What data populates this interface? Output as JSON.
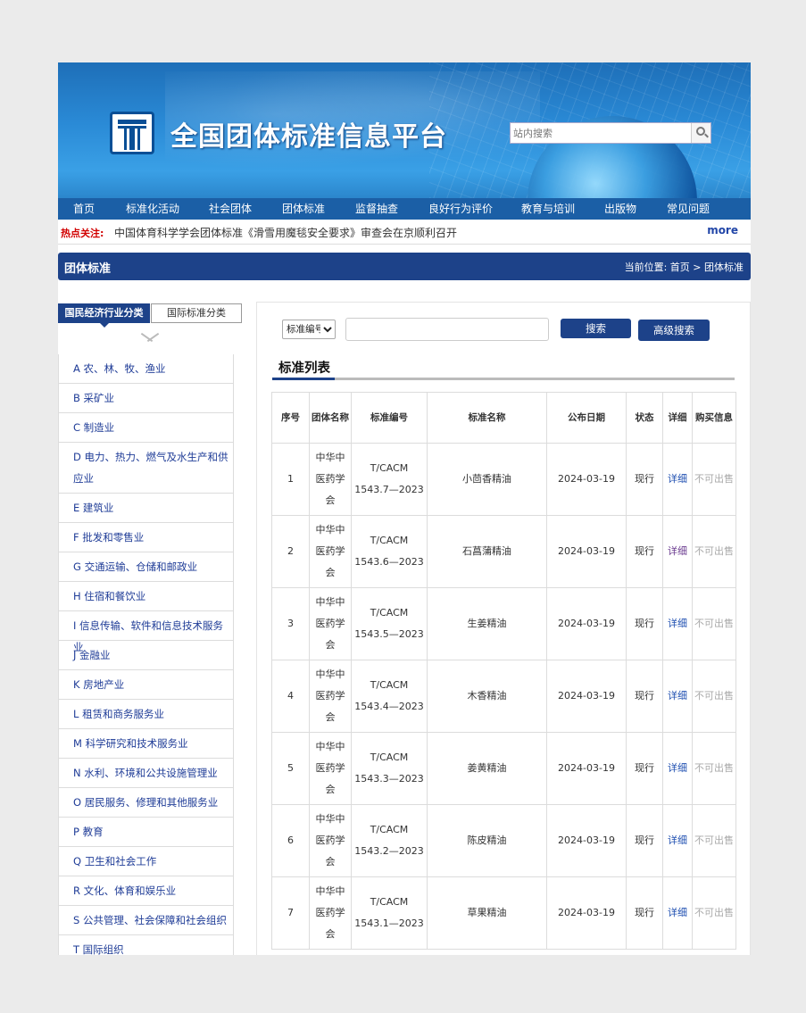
{
  "header": {
    "site_title": "全国团体标准信息平台",
    "search_placeholder": "站内搜索"
  },
  "nav": [
    "首页",
    "标准化活动",
    "社会团体",
    "团体标准",
    "监督抽查",
    "良好行为评价",
    "教育与培训",
    "出版物",
    "常见问题"
  ],
  "hot": {
    "label": "热点关注:",
    "text": "中国体育科学学会团体标准《滑雪用魔毯安全要求》审查会在京顺利召开",
    "more": "more"
  },
  "section": {
    "title": "团体标准",
    "breadcrumb": "当前位置: 首页 > 团体标准"
  },
  "sidebar": {
    "tab_active": "国民经济行业分类",
    "tab_other": "国际标准分类",
    "categories": [
      "A 农、林、牧、渔业",
      "B 采矿业",
      "C 制造业",
      "D 电力、热力、燃气及水生产和供应业",
      "E 建筑业",
      "F 批发和零售业",
      "G 交通运输、仓储和邮政业",
      "H 住宿和餐饮业",
      "I 信息传输、软件和信息技术服务业",
      "J 金融业",
      "K 房地产业",
      "L 租赁和商务服务业",
      "M 科学研究和技术服务业",
      "N 水利、环境和公共设施管理业",
      "O 居民服务、修理和其他服务业",
      "P 教育",
      "Q 卫生和社会工作",
      "R 文化、体育和娱乐业",
      "S 公共管理、社会保障和社会组织",
      "T 国际组织"
    ]
  },
  "search": {
    "select_value": "标准编号",
    "search_label": "搜索",
    "advanced_label": "高级搜索"
  },
  "list": {
    "title": "标准列表",
    "columns": [
      "序号",
      "团体名称",
      "标准编号",
      "标准名称",
      "公布日期",
      "状态",
      "详细",
      "购买信息"
    ],
    "rows": [
      {
        "no": "1",
        "org": "中华中医药学会",
        "code": "T/CACM 1543.7—2023",
        "name": "小茴香精油",
        "date": "2024-03-19",
        "status": "现行",
        "detail": "详细",
        "buy": "不可出售"
      },
      {
        "no": "2",
        "org": "中华中医药学会",
        "code": "T/CACM 1543.6—2023",
        "name": "石菖蒲精油",
        "date": "2024-03-19",
        "status": "现行",
        "detail": "详细",
        "buy": "不可出售"
      },
      {
        "no": "3",
        "org": "中华中医药学会",
        "code": "T/CACM 1543.5—2023",
        "name": "生姜精油",
        "date": "2024-03-19",
        "status": "现行",
        "detail": "详细",
        "buy": "不可出售"
      },
      {
        "no": "4",
        "org": "中华中医药学会",
        "code": "T/CACM 1543.4—2023",
        "name": "木香精油",
        "date": "2024-03-19",
        "status": "现行",
        "detail": "详细",
        "buy": "不可出售"
      },
      {
        "no": "5",
        "org": "中华中医药学会",
        "code": "T/CACM 1543.3—2023",
        "name": "姜黄精油",
        "date": "2024-03-19",
        "status": "现行",
        "detail": "详细",
        "buy": "不可出售"
      },
      {
        "no": "6",
        "org": "中华中医药学会",
        "code": "T/CACM 1543.2—2023",
        "name": "陈皮精油",
        "date": "2024-03-19",
        "status": "现行",
        "detail": "详细",
        "buy": "不可出售"
      },
      {
        "no": "7",
        "org": "中华中医药学会",
        "code": "T/CACM 1543.1—2023",
        "name": "草果精油",
        "date": "2024-03-19",
        "status": "现行",
        "detail": "详细",
        "buy": "不可出售"
      }
    ]
  }
}
